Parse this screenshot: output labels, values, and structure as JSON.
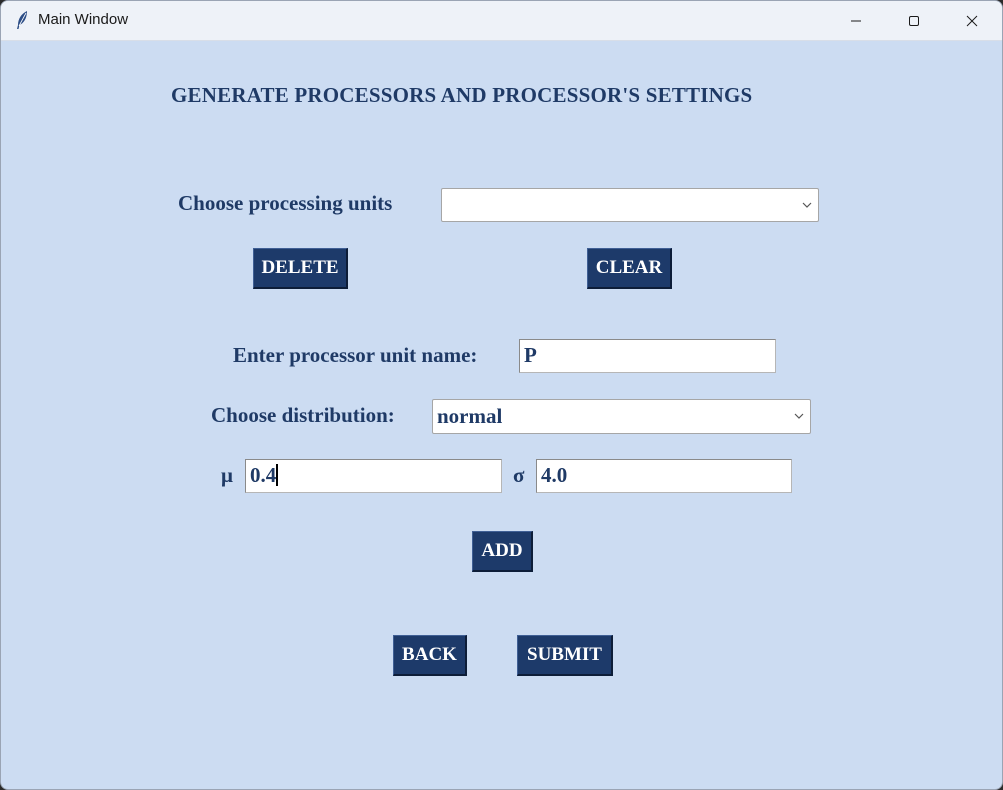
{
  "window": {
    "title": "Main Window",
    "icon": "feather-icon",
    "controls": [
      "minimize-icon",
      "maximize-icon",
      "close-icon"
    ]
  },
  "heading": "GENERATE PROCESSORS AND PROCESSOR'S SETTINGS",
  "processing_units": {
    "label": "Choose processing units",
    "selected": ""
  },
  "buttons": {
    "delete": "DELETE",
    "clear": "CLEAR",
    "add": "ADD",
    "back": "BACK",
    "submit": "SUBMIT"
  },
  "processor_name": {
    "label": "Enter processor unit name:",
    "value": "P"
  },
  "distribution": {
    "label": "Choose distribution:",
    "selected": "normal"
  },
  "params": {
    "mu_label": "μ",
    "mu_value": "0.4",
    "sigma_label": "σ",
    "sigma_value": "4.0"
  },
  "colors": {
    "background": "#ccdcf2",
    "text": "#1f3a66",
    "button": "#1d3a6a",
    "button_text": "#ffffff"
  }
}
